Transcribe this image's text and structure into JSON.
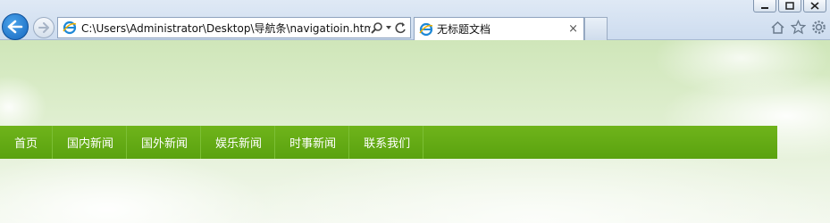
{
  "browser": {
    "address_url": "C:\\Users\\Administrator\\Desktop\\导航条\\navigatioin.html",
    "tab_title": "无标题文档",
    "tab_close": "×"
  },
  "page": {
    "nav_items": [
      "首页",
      "国内新闻",
      "国外新闻",
      "娱乐新闻",
      "时事新闻",
      "联系我们"
    ]
  },
  "colors": {
    "nav_bg": "#62aa14",
    "nav_text": "#ffffff",
    "chrome_bg": "#d6e3f2"
  }
}
